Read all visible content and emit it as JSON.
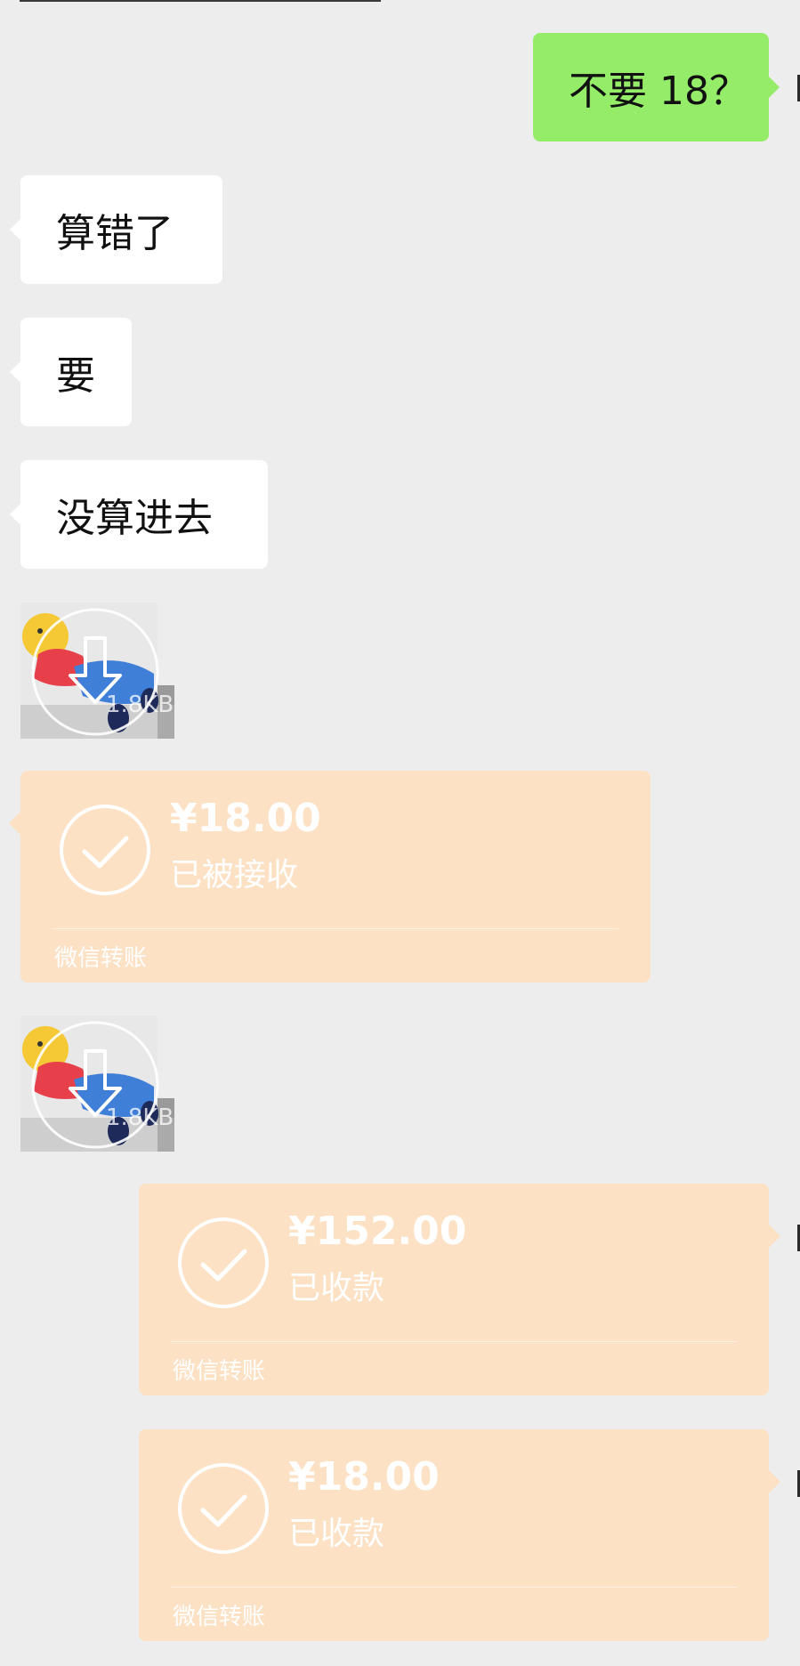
{
  "messages": {
    "m1": {
      "direction": "sent",
      "text": "不要 18？"
    },
    "m2": {
      "direction": "received",
      "text": "算错了"
    },
    "m3": {
      "direction": "received",
      "text": "要"
    },
    "m4": {
      "direction": "received",
      "text": "没算进去"
    },
    "m5": {
      "direction": "received",
      "type": "sticker",
      "icon": "download-icon",
      "size": "1.8KB"
    },
    "m6": {
      "direction": "received",
      "type": "transfer",
      "icon": "check-circle-icon",
      "amount": "¥18.00",
      "status": "已被接收",
      "footer": "微信转账"
    },
    "m7": {
      "direction": "received",
      "type": "sticker",
      "icon": "download-icon",
      "size": "1.8KB"
    },
    "m8": {
      "direction": "sent",
      "type": "transfer",
      "icon": "check-circle-icon",
      "amount": "¥152.00",
      "status": "已收款",
      "footer": "微信转账"
    },
    "m9": {
      "direction": "sent",
      "type": "transfer",
      "icon": "check-circle-icon",
      "amount": "¥18.00",
      "status": "已收款",
      "footer": "微信转账"
    }
  },
  "colors": {
    "background": "#ededed",
    "sent_bubble": "#95ec69",
    "received_bubble": "#ffffff",
    "transfer_card": "#fce1c4"
  }
}
